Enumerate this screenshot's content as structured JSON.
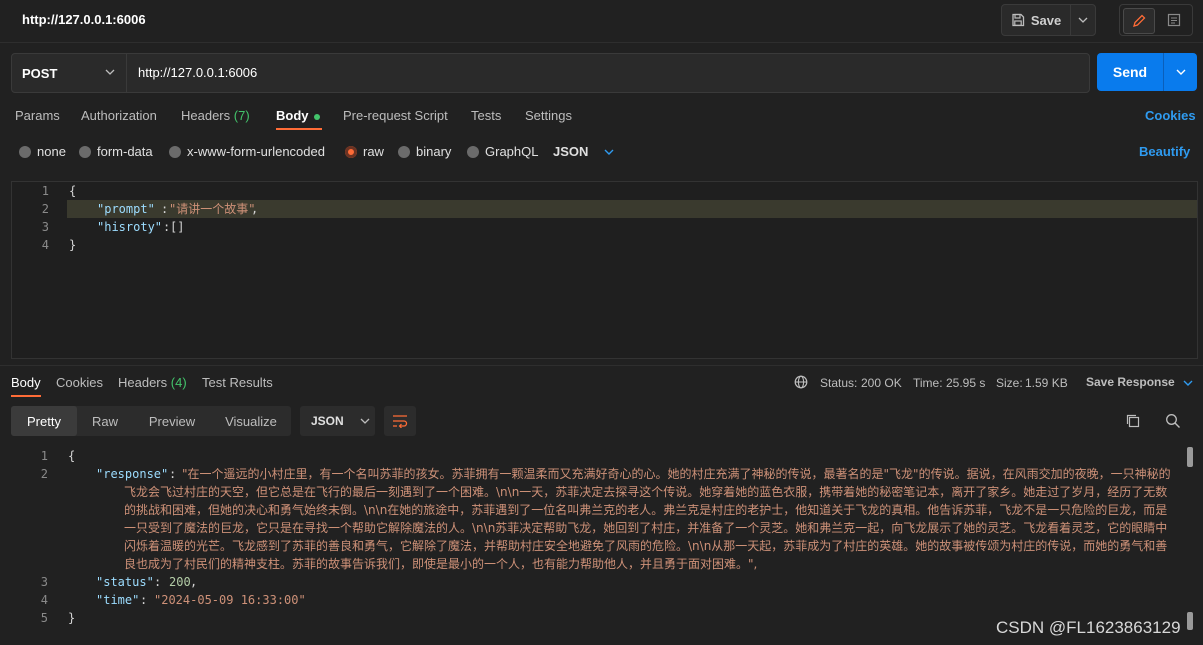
{
  "title": "http://127.0.0.1:6006",
  "toolbar": {
    "save_label": "Save"
  },
  "request": {
    "method": "POST",
    "url": "http://127.0.0.1:6006",
    "send_label": "Send"
  },
  "tabs": {
    "params": "Params",
    "authorization": "Authorization",
    "headers": "Headers",
    "headers_count": "(7)",
    "body": "Body",
    "prerequest": "Pre-request Script",
    "tests": "Tests",
    "settings": "Settings",
    "cookies": "Cookies"
  },
  "body_types": {
    "none": "none",
    "form_data": "form-data",
    "urlencoded": "x-www-form-urlencoded",
    "raw": "raw",
    "binary": "binary",
    "graphql": "GraphQL",
    "format": "JSON",
    "beautify": "Beautify",
    "selected": "raw"
  },
  "request_body": {
    "line_numbers": [
      "1",
      "2",
      "3",
      "4"
    ],
    "open": "{",
    "key1": "\"prompt\"",
    "val1": "\"请讲一个故事\"",
    "key2": "\"hisroty\"",
    "val2": "[]",
    "close": "}"
  },
  "response_tabs": {
    "body": "Body",
    "cookies": "Cookies",
    "headers": "Headers",
    "headers_count": "(4)",
    "test_results": "Test Results"
  },
  "response_status": {
    "status_label": "Status:",
    "status_value": "200 OK",
    "time_label": "Time:",
    "time_value": "25.95 s",
    "size_label": "Size:",
    "size_value": "1.59 KB",
    "save_response": "Save Response"
  },
  "view_modes": {
    "pretty": "Pretty",
    "raw": "Raw",
    "preview": "Preview",
    "visualize": "Visualize",
    "format": "JSON"
  },
  "response_body": {
    "line_numbers": [
      "1",
      "2",
      "3",
      "4",
      "5"
    ],
    "open": "{",
    "key_response": "\"response\"",
    "response_lines": [
      "\"在一个遥远的小村庄里，有一个名叫苏菲的孩女。苏菲拥有一颗温柔而又充满好奇心的心。她的村庄充满了神秘的传说，最著名的是\"飞龙\"的传说。据说，在风雨交加的夜晚，一只神秘的",
      "飞龙会飞过村庄的天空，但它总是在飞行的最后一刻遇到了一个困难。\\n\\n一天，苏菲决定去探寻这个传说。她穿着她的蓝色衣服，携带着她的秘密笔记本，离开了家乡。她走过了岁月，经历了无数",
      "的挑战和困难，但她的决心和勇气始终未倒。\\n\\n在她的旅途中，苏菲遇到了一位名叫弗兰克的老人。弗兰克是村庄的老护士，他知道关于飞龙的真相。他告诉苏菲，飞龙不是一只危险的巨龙，而是",
      "一只受到了魔法的巨龙，它只是在寻找一个帮助它解除魔法的人。\\n\\n苏菲决定帮助飞龙，她回到了村庄，并准备了一个灵芝。她和弗兰克一起，向飞龙展示了她的灵芝。飞龙看着灵芝，它的眼睛中",
      "闪烁着温暖的光芒。飞龙感到了苏菲的善良和勇气，它解除了魔法，并帮助村庄安全地避免了风雨的危险。\\n\\n从那一天起，苏菲成为了村庄的英雄。她的故事被传颂为村庄的传说，而她的勇气和善",
      "良也成为了村民们的精神支柱。苏菲的故事告诉我们，即使是最小的一个人，也有能力帮助他人，并且勇于面对困难。\","
    ],
    "key_status": "\"status\"",
    "val_status": "200",
    "key_time": "\"time\"",
    "val_time": "\"2024-05-09 16:33:00\"",
    "close": "}"
  },
  "watermark": "CSDN @FL1623863129",
  "colors": {
    "accent": "#ff6c37",
    "send": "#097bed",
    "link": "#2f9bf0",
    "success": "#43c46b"
  },
  "icons": [
    "save-icon",
    "chevron-down-icon",
    "pencil-icon",
    "document-icon",
    "globe-icon",
    "wrap-lines-icon",
    "copy-icon",
    "search-icon"
  ]
}
